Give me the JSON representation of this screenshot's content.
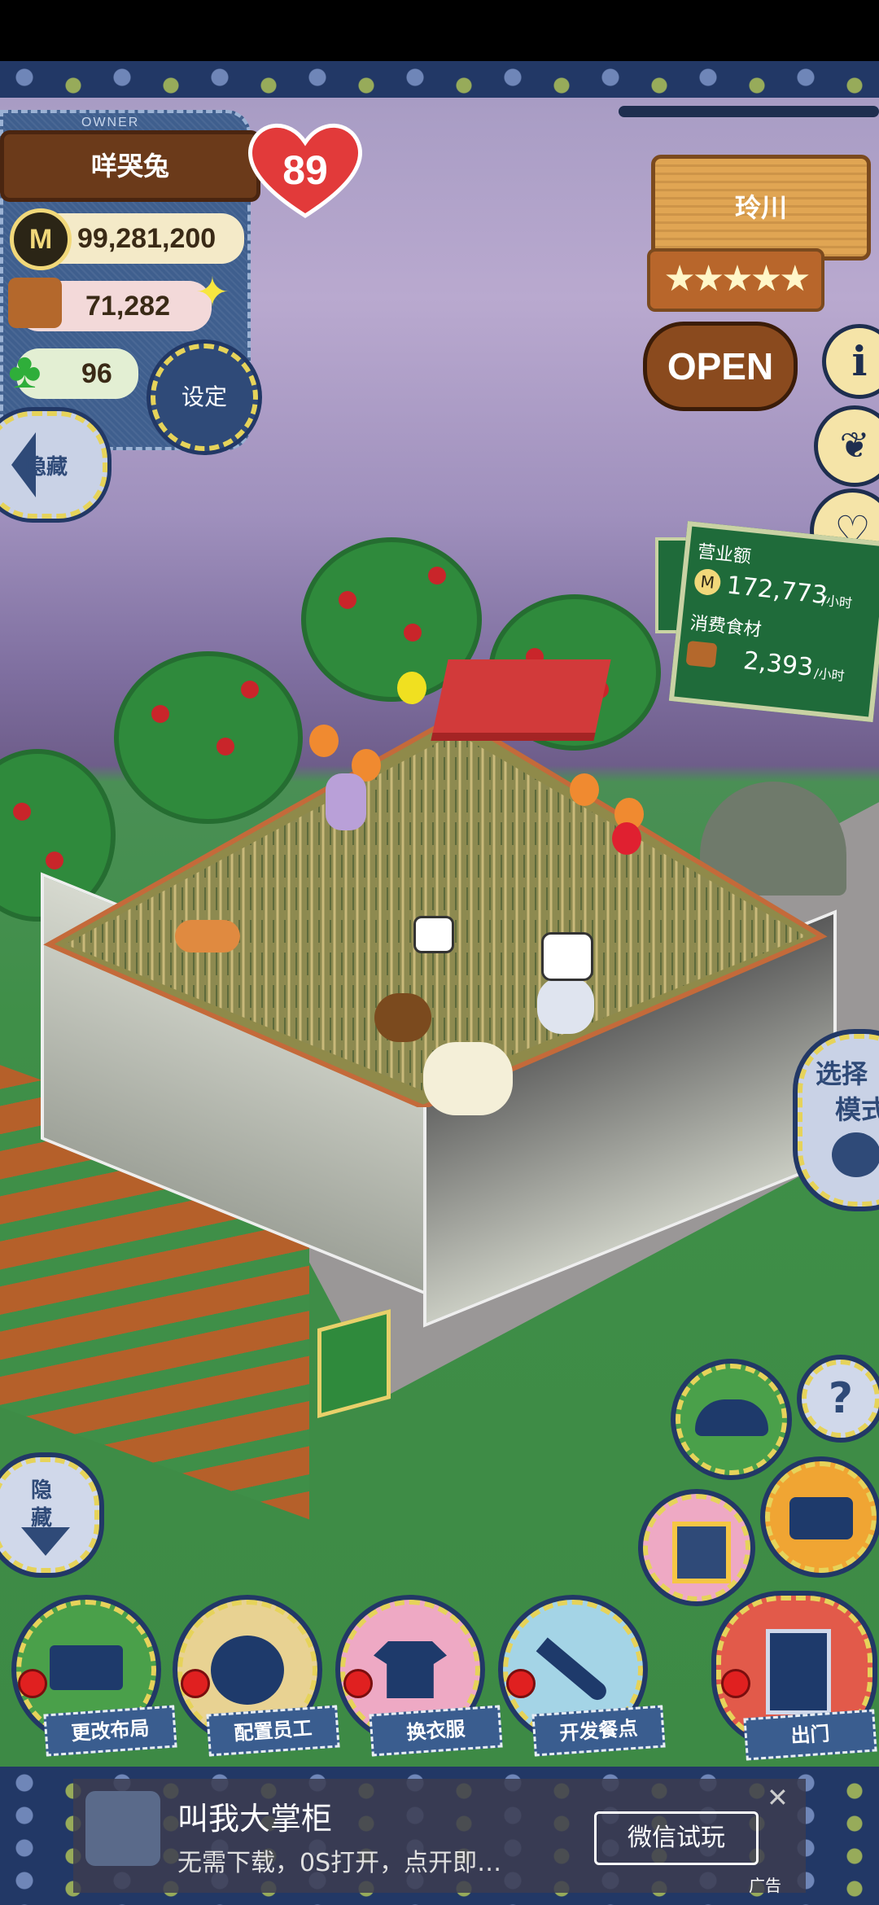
{
  "owner": {
    "owner_label": "OWNER",
    "name": "咩哭兔",
    "level": "89",
    "coins": "99,281,200",
    "ingredients": "71,282",
    "clover": "96",
    "settings_label": "设定",
    "hide_top_label": "隐藏"
  },
  "shop_sign": {
    "name": "玲川",
    "stars": 5,
    "status": "OPEN"
  },
  "revenue_board": {
    "revenue_label": "营业额",
    "revenue_value": "172,773",
    "revenue_unit": "/小时",
    "consume_label": "消费食材",
    "consume_value": "2,393",
    "consume_unit": "/小时"
  },
  "side_buttons": {
    "mode_label_1": "选择",
    "mode_label_2": "模式",
    "help": "?",
    "hide_bottom_1": "隐",
    "hide_bottom_2": "藏"
  },
  "toolbar": {
    "layout": "更改布局",
    "staff": "配置员工",
    "clothes": "换衣服",
    "menu": "开发餐点",
    "exit": "出门"
  },
  "ad": {
    "title": "叫我大掌柜",
    "subtitle": "无需下载，0S打开，点开即…",
    "button": "微信试玩",
    "tag": "广告"
  },
  "colors": {
    "sky": "#a89cc4",
    "grass": "#3f8f48",
    "denim": "#3f5f8e",
    "wood": "#e0a553",
    "heart": "#e23a3a",
    "chalkboard": "#1f6b3a"
  }
}
